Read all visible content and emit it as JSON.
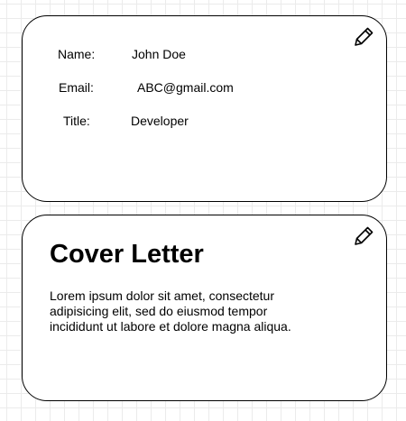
{
  "profile": {
    "fields": [
      {
        "label": "Name:",
        "value": "John Doe"
      },
      {
        "label": "Email:",
        "value": "ABC@gmail.com"
      },
      {
        "label": "Title:",
        "value": "Developer"
      }
    ],
    "edit_icon": "pencil-icon"
  },
  "cover_letter": {
    "title": "Cover Letter",
    "body": "Lorem ipsum dolor sit amet, consectetur adipisicing elit, sed do eiusmod tempor incididunt ut labore et dolore magna aliqua.",
    "edit_icon": "pencil-icon"
  }
}
